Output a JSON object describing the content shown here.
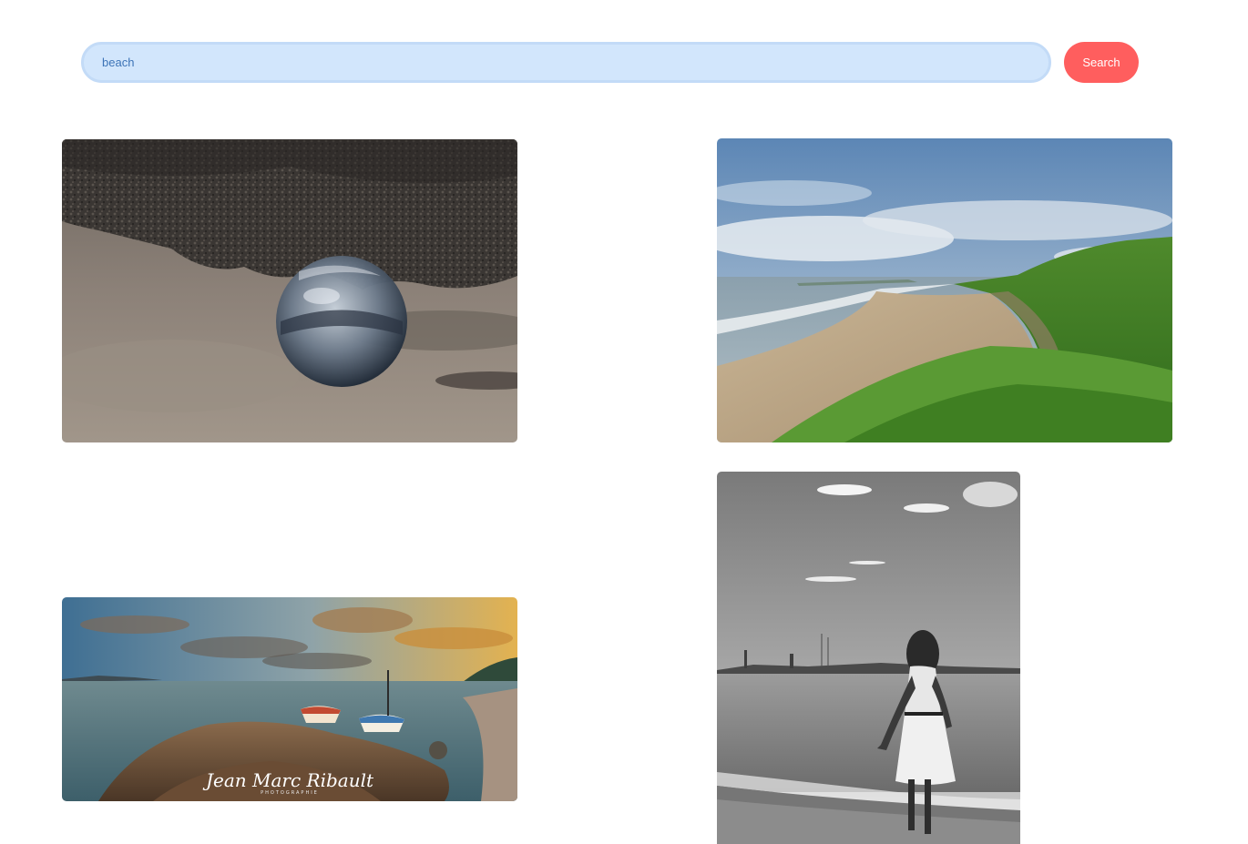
{
  "search": {
    "value": "beach",
    "button_label": "Search"
  },
  "results": [
    {
      "subject": "crystal-ball-sand-icon"
    },
    {
      "subject": "coastal-bay-icon"
    },
    {
      "subject": "rocky-shore-boats-icon",
      "watermark": {
        "name": "Jean Marc Ribault",
        "tagline": "PHOTOGRAPHIE"
      }
    },
    {
      "subject": "woman-shoreline-bw-icon"
    }
  ]
}
